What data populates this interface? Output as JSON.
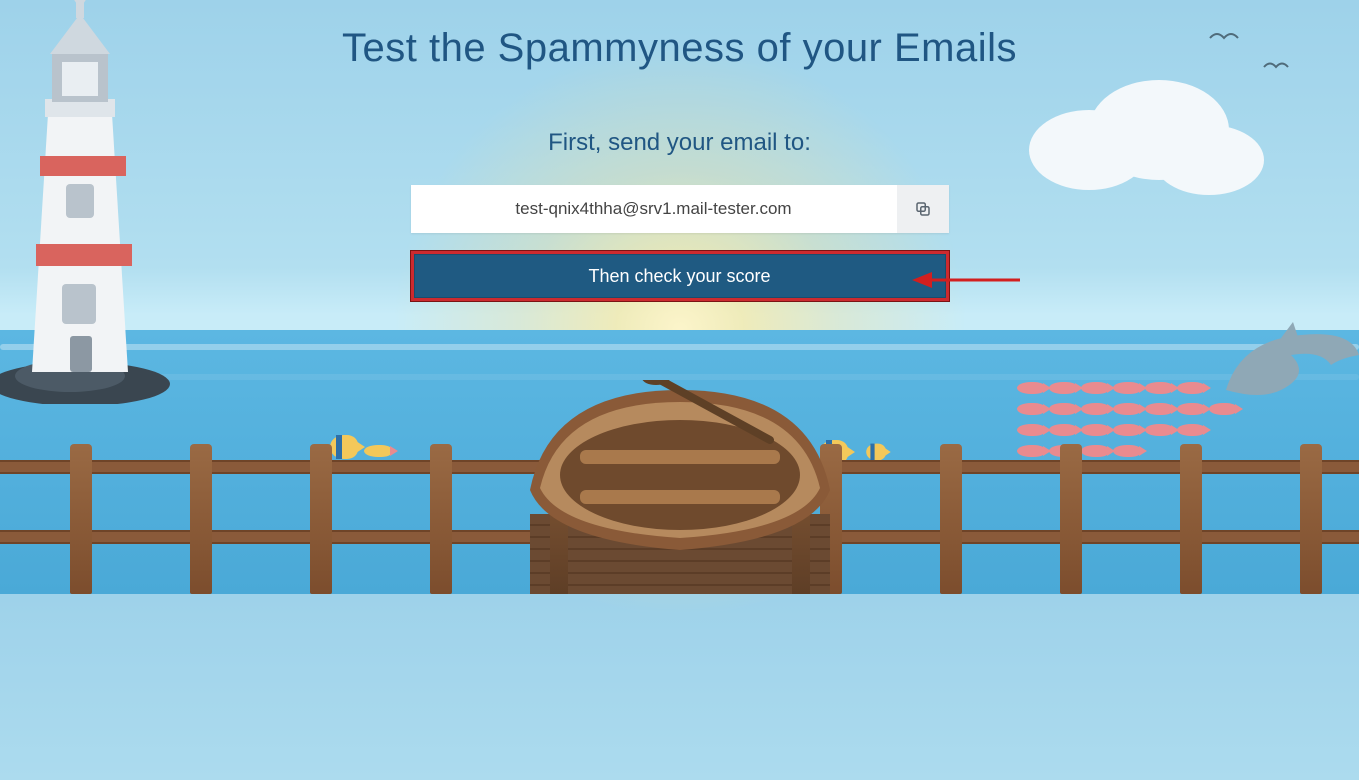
{
  "headline": "Test the Spammyness of your Emails",
  "subhead": "First, send your email to:",
  "email_value": "test-qnix4thha@srv1.mail-tester.com",
  "copy_button_label": "Copy",
  "check_button_label": "Then check your score"
}
